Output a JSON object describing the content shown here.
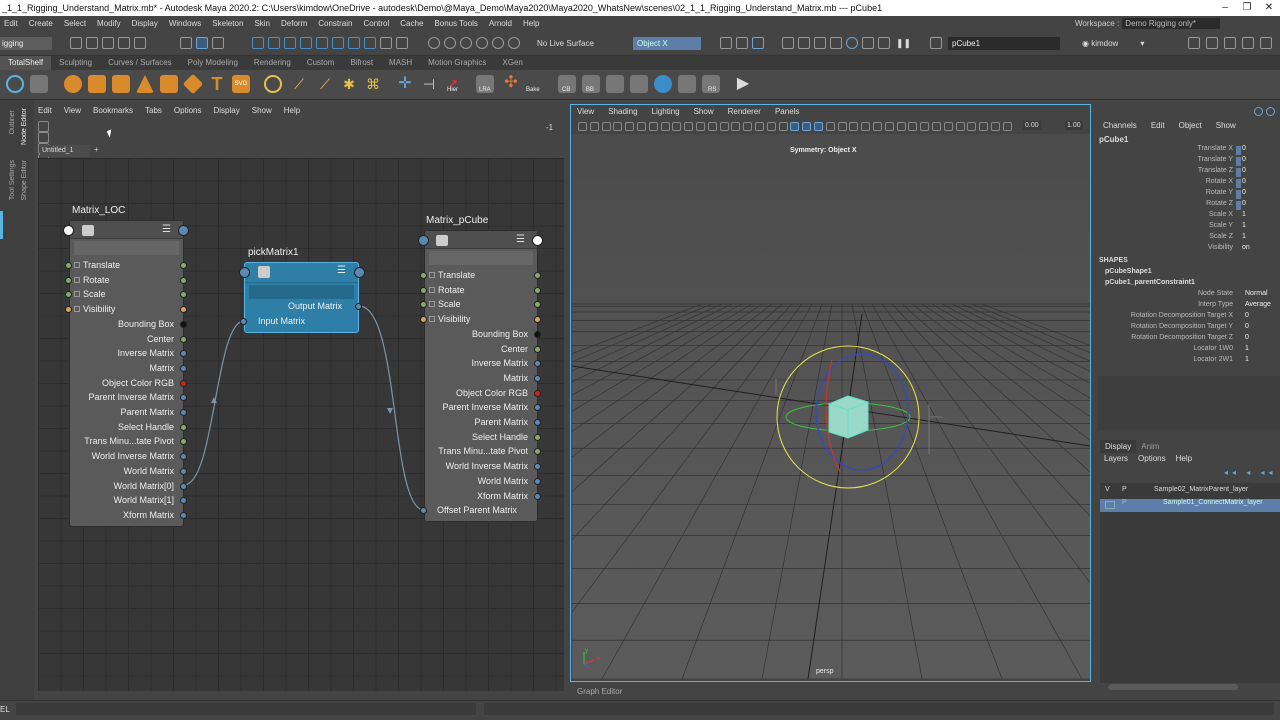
{
  "window": {
    "title": "_1_1_Rigging_Understand_Matrix.mb* - Autodesk Maya 2020.2: C:\\Users\\kimdow\\OneDrive - autodesk\\Demo\\@Maya_Demo\\Maya2020\\Maya2020_WhatsNew\\scenes\\02_1_1_Rigging_Understand_Matrix.mb  ---  pCube1"
  },
  "main_menu": [
    "Edit",
    "Create",
    "Select",
    "Modify",
    "Display",
    "Windows",
    "Skeleton",
    "Skin",
    "Deform",
    "Constrain",
    "Control",
    "Cache",
    "Bonus Tools",
    "Arnold",
    "Help"
  ],
  "workspace": {
    "label": "Workspace :",
    "value": "Demo Rigging only*"
  },
  "status_line": {
    "mode": "igging",
    "live_surface": "No Live Surface",
    "symmetry": "Object X",
    "selection": "pCube1",
    "user": "kimdow"
  },
  "shelf_tabs": [
    "TotalShelf",
    "Sculpting",
    "Curves / Surfaces",
    "Poly Modeling",
    "Rendering",
    "Custom",
    "Bifrost",
    "MASH",
    "Motion Graphics",
    "XGen"
  ],
  "shelf_labels": {
    "hier": "Hier",
    "lra": "LRA",
    "bake": "Bake",
    "cb": "CB",
    "bb": "BB",
    "rs": "RS",
    "svg": "SVG"
  },
  "left_tabs": [
    "Outliner",
    "Node Editor",
    "Tool Settings",
    "Shape Editor"
  ],
  "node_editor": {
    "menu": [
      "Edit",
      "View",
      "Bookmarks",
      "Tabs",
      "Options",
      "Display",
      "Show",
      "Help"
    ],
    "tab": "Untitled_1",
    "tab_add": "+",
    "toolbar_value": "-1",
    "nodes": {
      "matrix_loc": {
        "title": "Matrix_LOC",
        "inputs": [
          "Translate",
          "Rotate",
          "Scale",
          "Visibility"
        ],
        "outputs": [
          "Bounding Box",
          "Center",
          "Inverse Matrix",
          "Matrix",
          "Object Color RGB",
          "Parent Inverse Matrix",
          "Parent Matrix",
          "Select Handle",
          "Trans Minu...tate Pivot",
          "World Inverse Matrix",
          "World Matrix",
          "World Matrix[0]",
          "World Matrix[1]",
          "Xform Matrix"
        ]
      },
      "pick_matrix": {
        "title": "pickMatrix1",
        "output": "Output Matrix",
        "input": "Input Matrix"
      },
      "matrix_pcube": {
        "title": "Matrix_pCube",
        "inputs": [
          "Translate",
          "Rotate",
          "Scale",
          "Visibility"
        ],
        "outputs": [
          "Bounding Box",
          "Center",
          "Inverse Matrix",
          "Matrix",
          "Object Color RGB",
          "Parent Inverse Matrix",
          "Parent Matrix",
          "Select Handle",
          "Trans Minu...tate Pivot",
          "World Inverse Matrix",
          "World Matrix",
          "Xform Matrix"
        ],
        "extra_input": "Offset Parent Matrix"
      }
    }
  },
  "viewport": {
    "menu": [
      "View",
      "Shading",
      "Lighting",
      "Show",
      "Renderer",
      "Panels"
    ],
    "symmetry_text": "Symmetry: Object X",
    "camera": "persp",
    "near_value": "0.00",
    "far_value": "1.00",
    "bottom_label": "Graph Editor",
    "axis_y": "y",
    "axis_x": "x"
  },
  "channel_box": {
    "menu": [
      "Channels",
      "Edit",
      "Object",
      "Show"
    ],
    "object": "pCube1",
    "channels": [
      {
        "label": "Translate X",
        "value": "0"
      },
      {
        "label": "Translate Y",
        "value": "0"
      },
      {
        "label": "Translate Z",
        "value": "0"
      },
      {
        "label": "Rotate X",
        "value": "0"
      },
      {
        "label": "Rotate Y",
        "value": "0"
      },
      {
        "label": "Rotate Z",
        "value": "0"
      },
      {
        "label": "Scale X",
        "value": "1"
      },
      {
        "label": "Scale Y",
        "value": "1"
      },
      {
        "label": "Scale Z",
        "value": "1"
      },
      {
        "label": "Visibility",
        "value": "on"
      }
    ],
    "shapes_header": "SHAPES",
    "shapes": [
      "pCubeShape1",
      "pCube1_parentConstraint1"
    ],
    "constraint_attrs": [
      {
        "label": "Node State",
        "value": "Normal"
      },
      {
        "label": "Interp Type",
        "value": "Average"
      },
      {
        "label": "Rotation Decomposition Target X",
        "value": "0"
      },
      {
        "label": "Rotation Decomposition Target Y",
        "value": "0"
      },
      {
        "label": "Rotation Decomposition Target Z",
        "value": "0"
      },
      {
        "label": "Locator 1W0",
        "value": "1"
      },
      {
        "label": "Locator 2W1",
        "value": "1"
      }
    ]
  },
  "layer_editor": {
    "tabs": [
      "Display",
      "Anim"
    ],
    "menu": [
      "Layers",
      "Options",
      "Help"
    ],
    "layers": [
      {
        "v": "V",
        "p": "P",
        "name": "Sample02_MatrixParent_layer"
      },
      {
        "v": "",
        "p": "P",
        "name": "Sample01_ConnectMatrix_layer"
      }
    ]
  },
  "status_bar": {
    "left": "EL"
  }
}
